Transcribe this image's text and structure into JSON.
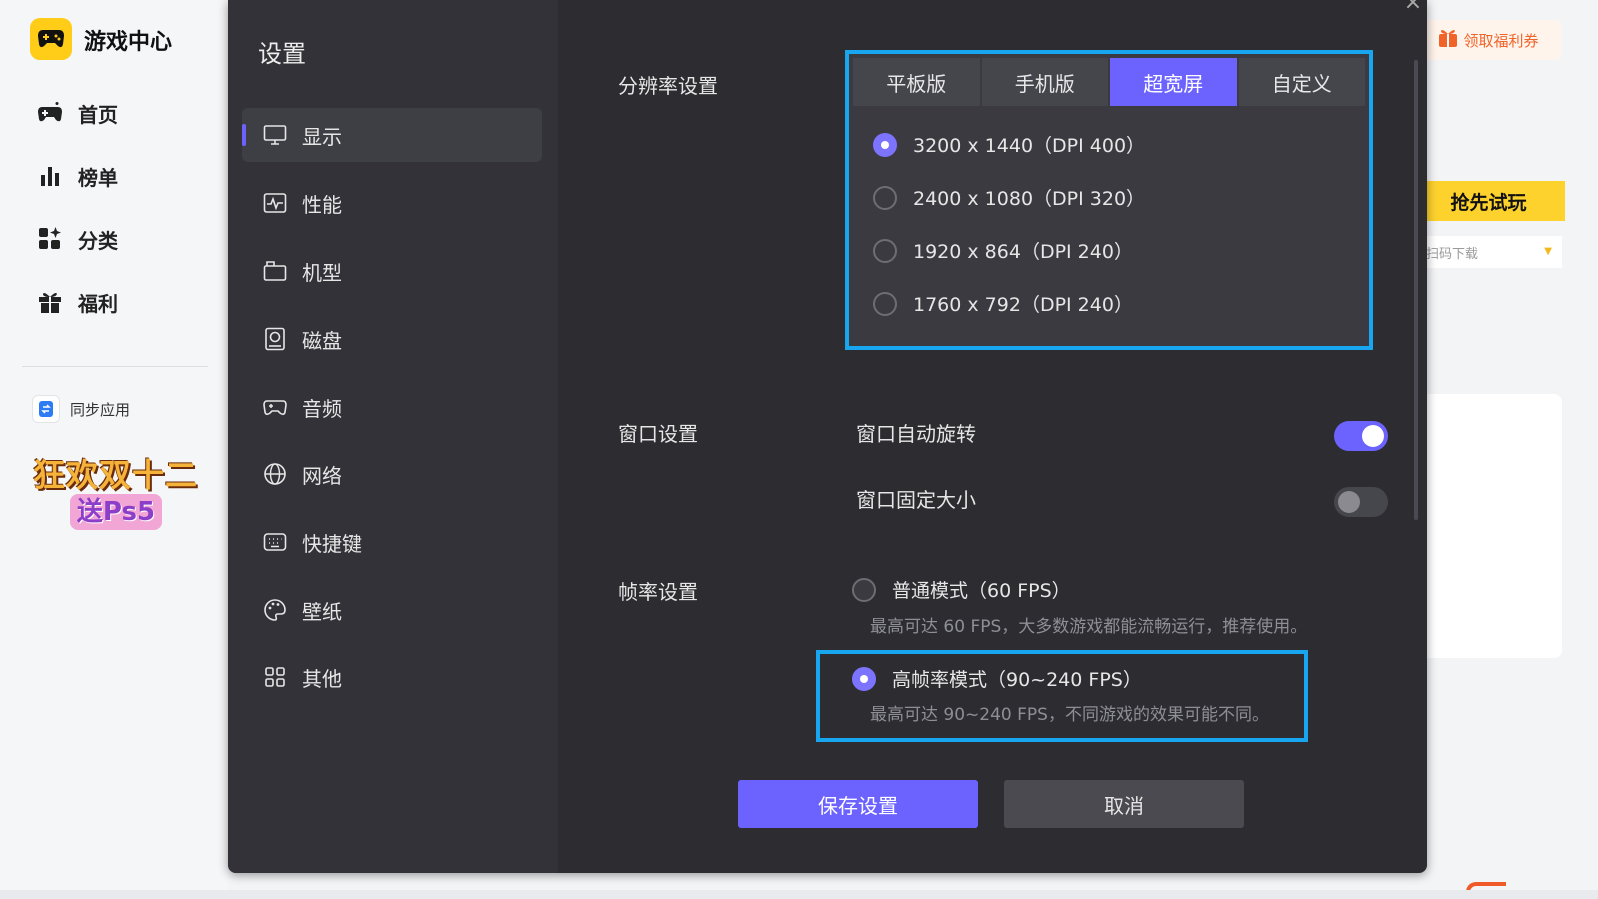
{
  "app": {
    "title": "游戏中心",
    "nav": [
      {
        "label": "首页",
        "icon": "gamepad-icon"
      },
      {
        "label": "榜单",
        "icon": "bar-chart-icon"
      },
      {
        "label": "分类",
        "icon": "category-grid-icon"
      },
      {
        "label": "福利",
        "icon": "gift-icon"
      }
    ],
    "sync_label": "同步应用",
    "promo": {
      "line1": "狂欢双十二",
      "line2": "送Ps5"
    }
  },
  "background": {
    "coupon_label": "领取福利券",
    "trial_label": "抢先试玩",
    "scan_label": "扫码下载"
  },
  "settings": {
    "title": "设置",
    "nav": [
      {
        "label": "显示",
        "icon": "monitor-icon",
        "active": true
      },
      {
        "label": "性能",
        "icon": "performance-icon"
      },
      {
        "label": "机型",
        "icon": "device-model-icon"
      },
      {
        "label": "磁盘",
        "icon": "disk-icon"
      },
      {
        "label": "音频",
        "icon": "audio-icon"
      },
      {
        "label": "网络",
        "icon": "globe-icon"
      },
      {
        "label": "快捷键",
        "icon": "keyboard-icon"
      },
      {
        "label": "壁纸",
        "icon": "palette-icon"
      },
      {
        "label": "其他",
        "icon": "apps-grid-icon"
      }
    ],
    "resolution": {
      "label": "分辨率设置",
      "tabs": [
        "平板版",
        "手机版",
        "超宽屏",
        "自定义"
      ],
      "active_tab": 2,
      "options": [
        {
          "label": "3200 x 1440（DPI 400）",
          "selected": true
        },
        {
          "label": "2400 x 1080（DPI 320）",
          "selected": false
        },
        {
          "label": "1920 x 864（DPI 240）",
          "selected": false
        },
        {
          "label": "1760 x 792（DPI 240）",
          "selected": false
        }
      ]
    },
    "window": {
      "label": "窗口设置",
      "auto_rotate": {
        "label": "窗口自动旋转",
        "on": true
      },
      "fixed_size": {
        "label": "窗口固定大小",
        "on": false
      }
    },
    "fps": {
      "label": "帧率设置",
      "normal": {
        "title": "普通模式（60 FPS）",
        "desc": "最高可达 60 FPS，大多数游戏都能流畅运行，推荐使用。",
        "selected": false
      },
      "high": {
        "title": "高帧率模式（90~240 FPS）",
        "desc": "最高可达 90~240 FPS，不同游戏的效果可能不同。",
        "selected": true
      }
    },
    "save_label": "保存设置",
    "cancel_label": "取消"
  },
  "colors": {
    "accent": "#6c63ff",
    "highlight_border": "#19a6f0",
    "dialog_bg": "#2c2c31",
    "brand_yellow": "#ffcc17"
  }
}
